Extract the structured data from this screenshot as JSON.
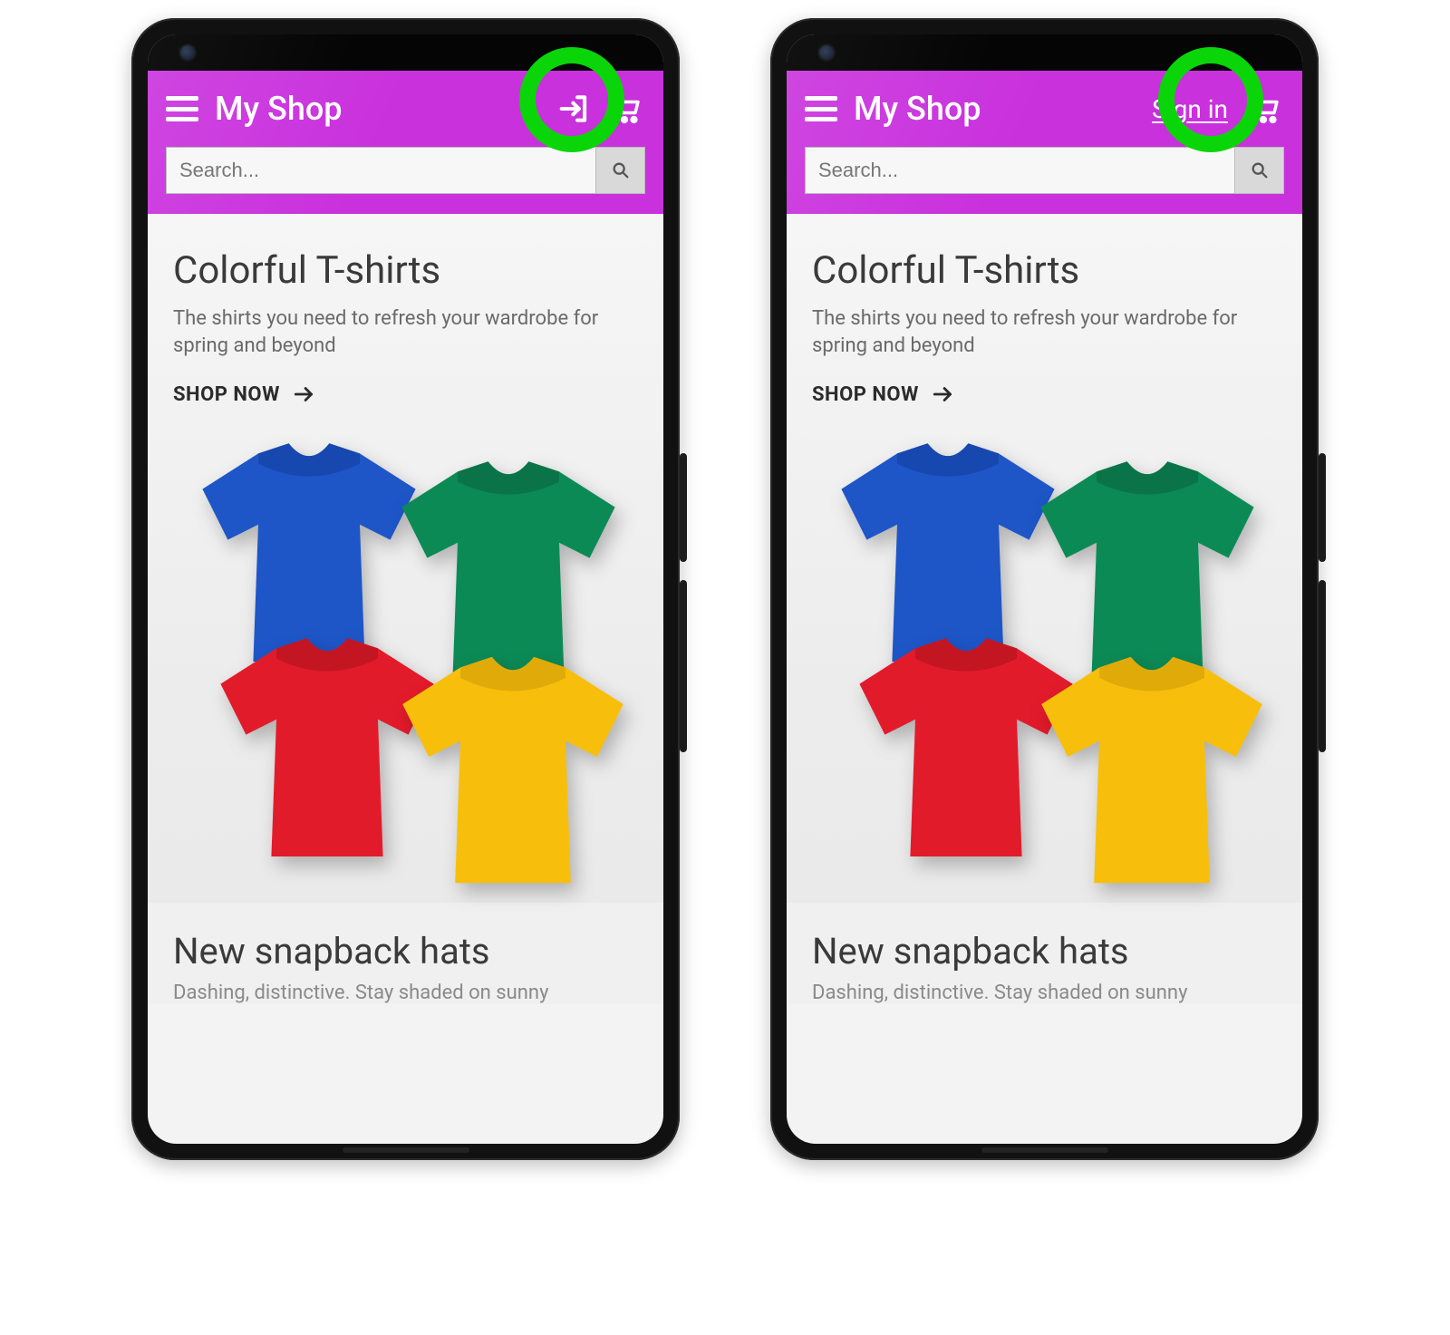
{
  "app": {
    "title": "My Shop",
    "signin_label": "Sign in"
  },
  "search": {
    "placeholder": "Search..."
  },
  "hero": {
    "title": "Colorful T-shirts",
    "subtitle": "The shirts you need to refresh your wardrobe for spring and beyond",
    "cta": "SHOP NOW"
  },
  "section2": {
    "title": "New snapback hats",
    "subtitle_partial": "Dashing, distinctive. Stay shaded on sunny"
  },
  "colors": {
    "brand": "#c931dd",
    "highlight": "#09d509"
  },
  "phones": [
    {
      "signin_mode": "icon"
    },
    {
      "signin_mode": "text"
    }
  ]
}
